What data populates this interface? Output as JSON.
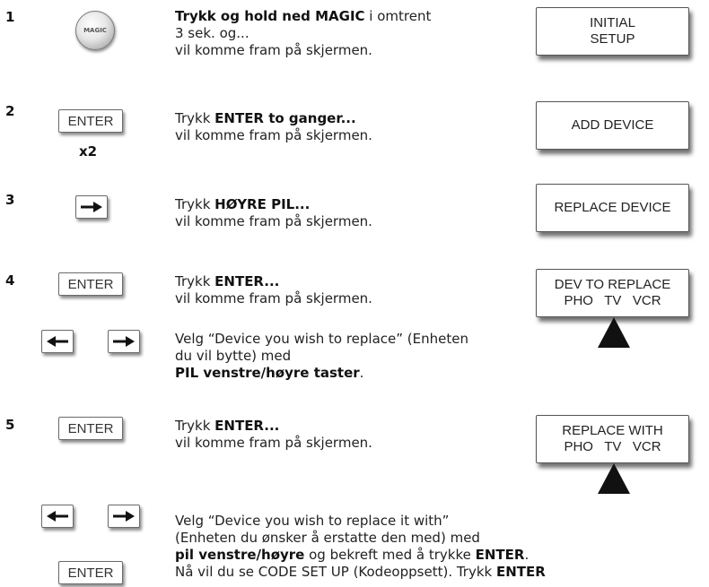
{
  "steps": [
    {
      "number": "1",
      "button": "MAGIC",
      "lines": [
        {
          "bold": "Trykk og hold ned MAGIC",
          "rest": " i omtrent"
        },
        {
          "text": "3 sek. og..."
        },
        {
          "text": "vil komme fram på skjermen."
        }
      ],
      "screen": [
        "INITIAL",
        "SETUP"
      ]
    },
    {
      "number": "2",
      "button": "ENTER",
      "multiplier": "x2",
      "lines": [
        {
          "pre": "Trykk ",
          "bold": "ENTER to ganger..."
        },
        {
          "text": "vil komme fram på skjermen."
        }
      ],
      "screen": [
        "ADD DEVICE"
      ]
    },
    {
      "number": "3",
      "button": "right-arrow",
      "lines": [
        {
          "pre": "Trykk ",
          "bold": "HØYRE PIL..."
        },
        {
          "text": "vil komme fram på skjermen."
        }
      ],
      "screen": [
        "REPLACE DEVICE"
      ]
    },
    {
      "number": "4",
      "button": "ENTER",
      "lines": [
        {
          "pre": "Trykk ",
          "bold": "ENTER..."
        },
        {
          "text": "vil komme fram på skjermen."
        }
      ],
      "screen": [
        "DEV TO REPLACE",
        "PHO   TV   VCR"
      ],
      "sub": {
        "buttons": [
          "left-arrow",
          "right-arrow"
        ],
        "lines": [
          {
            "text": "Velg “Device you wish to replace” (Enheten"
          },
          {
            "text": "du vil bytte) med"
          },
          {
            "bold": "PIL venstre/høyre taster",
            "rest": "."
          }
        ]
      }
    },
    {
      "number": "5",
      "button": "ENTER",
      "lines": [
        {
          "pre": "Trykk ",
          "bold": "ENTER..."
        },
        {
          "text": "vil komme fram på skjermen."
        }
      ],
      "screen": [
        "REPLACE WITH",
        "PHO   TV   VCR"
      ],
      "sub": {
        "buttons": [
          "left-arrow",
          "right-arrow",
          "ENTER"
        ],
        "lines": [
          {
            "text": "Velg “Device you wish to replace it with”"
          },
          {
            "text": "(Enheten du ønsker å erstatte den med) med"
          },
          {
            "bold": "pil venstre/høyre",
            "rest": " og bekreft med å trykke ",
            "bold2": "ENTER",
            "rest2": "."
          },
          {
            "text": "Nå vil du se CODE SET UP (Kodeoppsett). Trykk ",
            "bold": "ENTER"
          }
        ]
      }
    }
  ]
}
